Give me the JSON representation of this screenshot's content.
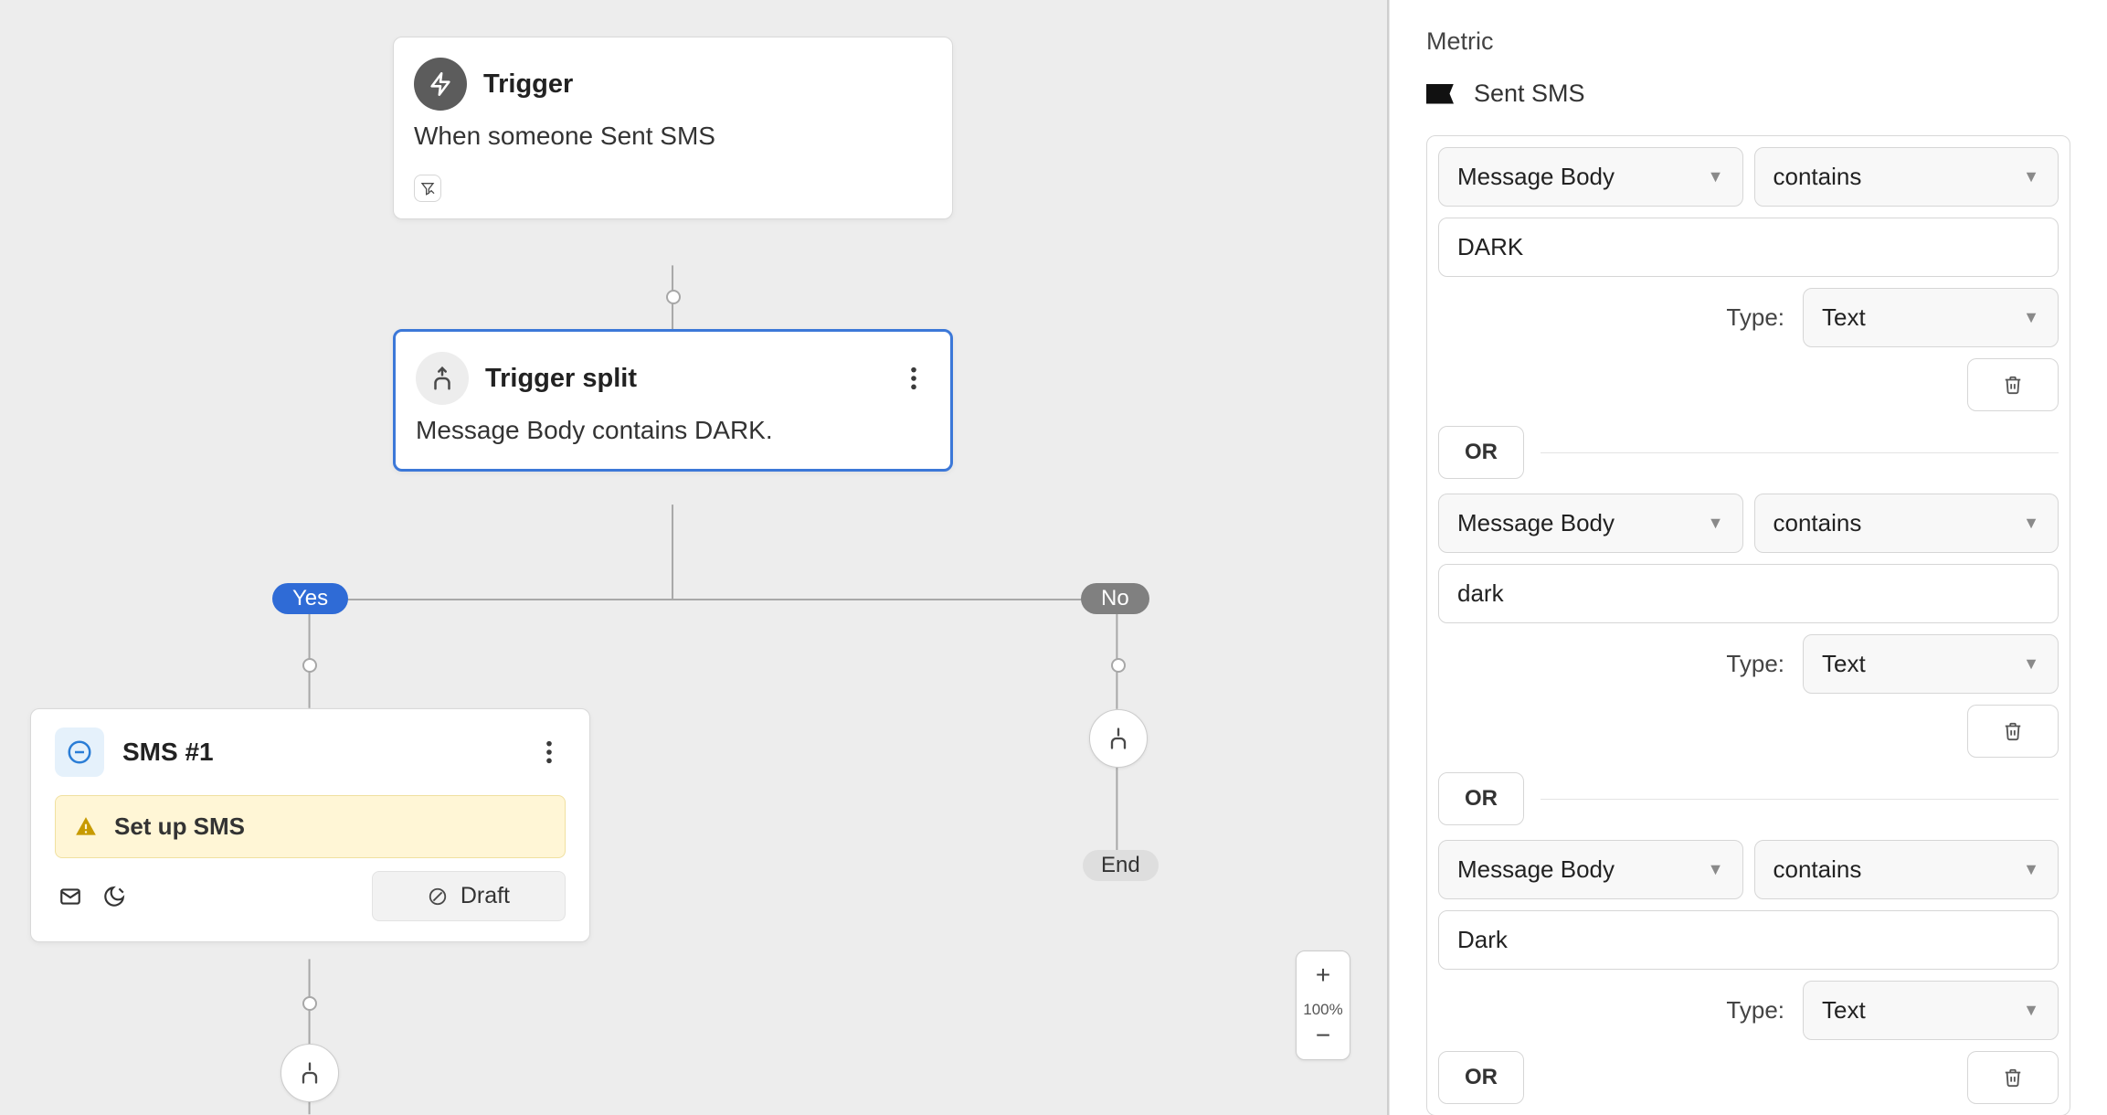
{
  "canvas": {
    "trigger": {
      "title": "Trigger",
      "description": "When someone Sent SMS"
    },
    "split": {
      "title": "Trigger split",
      "description": "Message Body contains DARK."
    },
    "paths": {
      "yes": "Yes",
      "no": "No",
      "end": "End"
    },
    "sms": {
      "title": "SMS #1",
      "warning": "Set up SMS",
      "status": "Draft"
    },
    "zoom": "100%"
  },
  "panel": {
    "section": "Metric",
    "metric_name": "Sent SMS",
    "type_label": "Type:",
    "or_label": "OR",
    "conditions": [
      {
        "dimension": "Message Body",
        "operator": "contains",
        "value": "DARK",
        "type": "Text"
      },
      {
        "dimension": "Message Body",
        "operator": "contains",
        "value": "dark",
        "type": "Text"
      },
      {
        "dimension": "Message Body",
        "operator": "contains",
        "value": "Dark",
        "type": "Text"
      }
    ]
  }
}
